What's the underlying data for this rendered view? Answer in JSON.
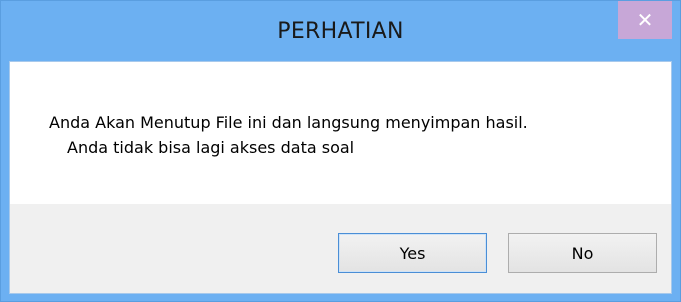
{
  "dialog": {
    "title": "PERHATIAN",
    "close_icon": "close-icon",
    "close_glyph": "✕",
    "message_line1": "Anda Akan Menutup File ini dan langsung menyimpan hasil.",
    "message_line2": "Anda tidak bisa lagi akses data soal",
    "yes_label": "Yes",
    "no_label": "No"
  },
  "colors": {
    "titlebar": "#6cb0f2",
    "close_button": "#c7a7d7",
    "client_background": "#f0f0f0",
    "message_background": "#ffffff"
  }
}
